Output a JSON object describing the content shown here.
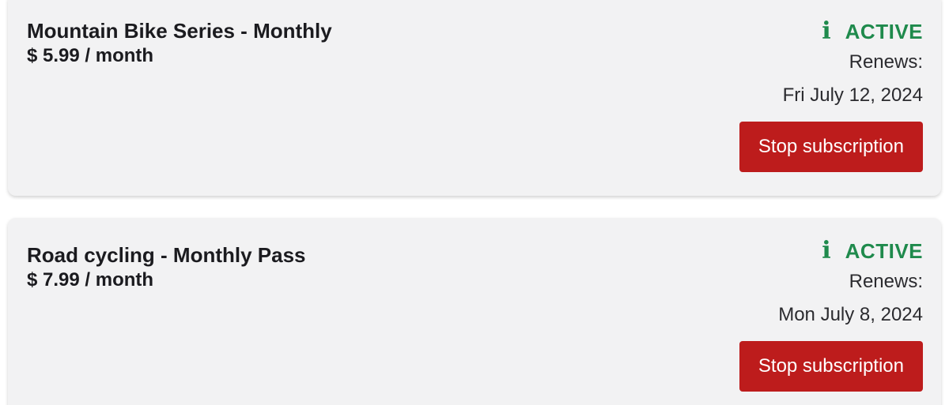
{
  "subscriptions": [
    {
      "title": "Mountain Bike Series - Monthly",
      "price": "$ 5.99 / month",
      "status_icon": "info-icon",
      "status": "ACTIVE",
      "renews_label": "Renews:",
      "renews_date": "Fri July 12, 2024",
      "button_label": "Stop subscription"
    },
    {
      "title": "Road cycling - Monthly Pass",
      "price": "$ 7.99 / month",
      "status_icon": "info-icon",
      "status": "ACTIVE",
      "renews_label": "Renews:",
      "renews_date": "Mon July 8, 2024",
      "button_label": "Stop subscription"
    }
  ],
  "colors": {
    "status_active": "#1f8a4c",
    "stop_button": "#bd1c1c",
    "card_background": "#f2f2f3"
  }
}
